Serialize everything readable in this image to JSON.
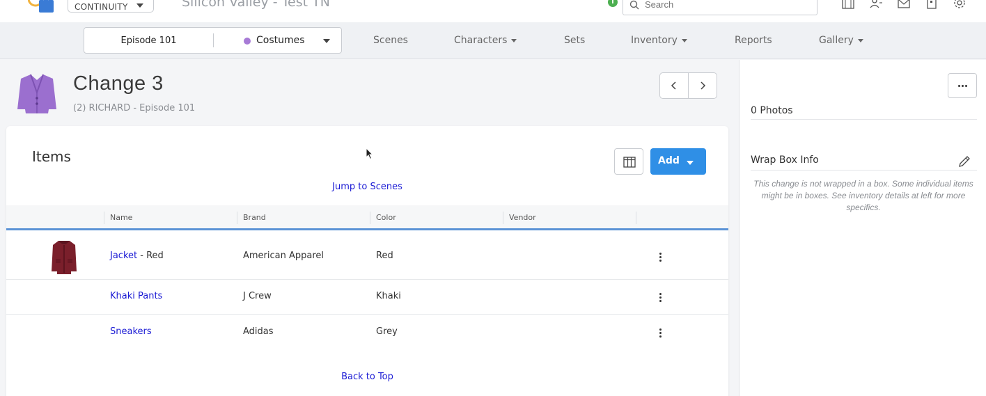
{
  "header": {
    "app_selector": "CONTINUITY",
    "project_title": "Silicon Valley - Test TN",
    "search_placeholder": "Search",
    "info_badge": "i"
  },
  "nav": {
    "episode": "Episode 101",
    "department": "Costumes",
    "department_color": "#a77ad6",
    "items": [
      {
        "label": "Scenes",
        "dropdown": false
      },
      {
        "label": "Characters",
        "dropdown": true
      },
      {
        "label": "Sets",
        "dropdown": false
      },
      {
        "label": "Inventory",
        "dropdown": true
      },
      {
        "label": "Reports",
        "dropdown": false
      },
      {
        "label": "Gallery",
        "dropdown": true
      }
    ]
  },
  "change": {
    "title": "Change 3",
    "subtitle": "(2) RICHARD - Episode 101"
  },
  "items_card": {
    "title": "Items",
    "add_label": "Add",
    "jump_link": "Jump to Scenes",
    "back_link": "Back to Top",
    "columns": [
      "Name",
      "Brand",
      "Color",
      "Vendor"
    ],
    "rows": [
      {
        "name": "Jacket",
        "suffix": " - Red",
        "brand": "American Apparel",
        "color": "Red",
        "vendor": ""
      },
      {
        "name": "Khaki Pants",
        "suffix": "",
        "brand": "J Crew",
        "color": "Khaki",
        "vendor": ""
      },
      {
        "name": "Sneakers",
        "suffix": "",
        "brand": "Adidas",
        "color": "Grey",
        "vendor": ""
      }
    ]
  },
  "right_panel": {
    "photos_label": "0 Photos",
    "wrap_box_label": "Wrap Box Info",
    "wrap_note": "This change is not wrapped in a box. Some individual items might be in boxes. See inventory details at left for more specifics."
  },
  "colors": {
    "accent": "#2f8fe6",
    "link": "#1a1ad4",
    "table_rule": "#5b93d6"
  }
}
